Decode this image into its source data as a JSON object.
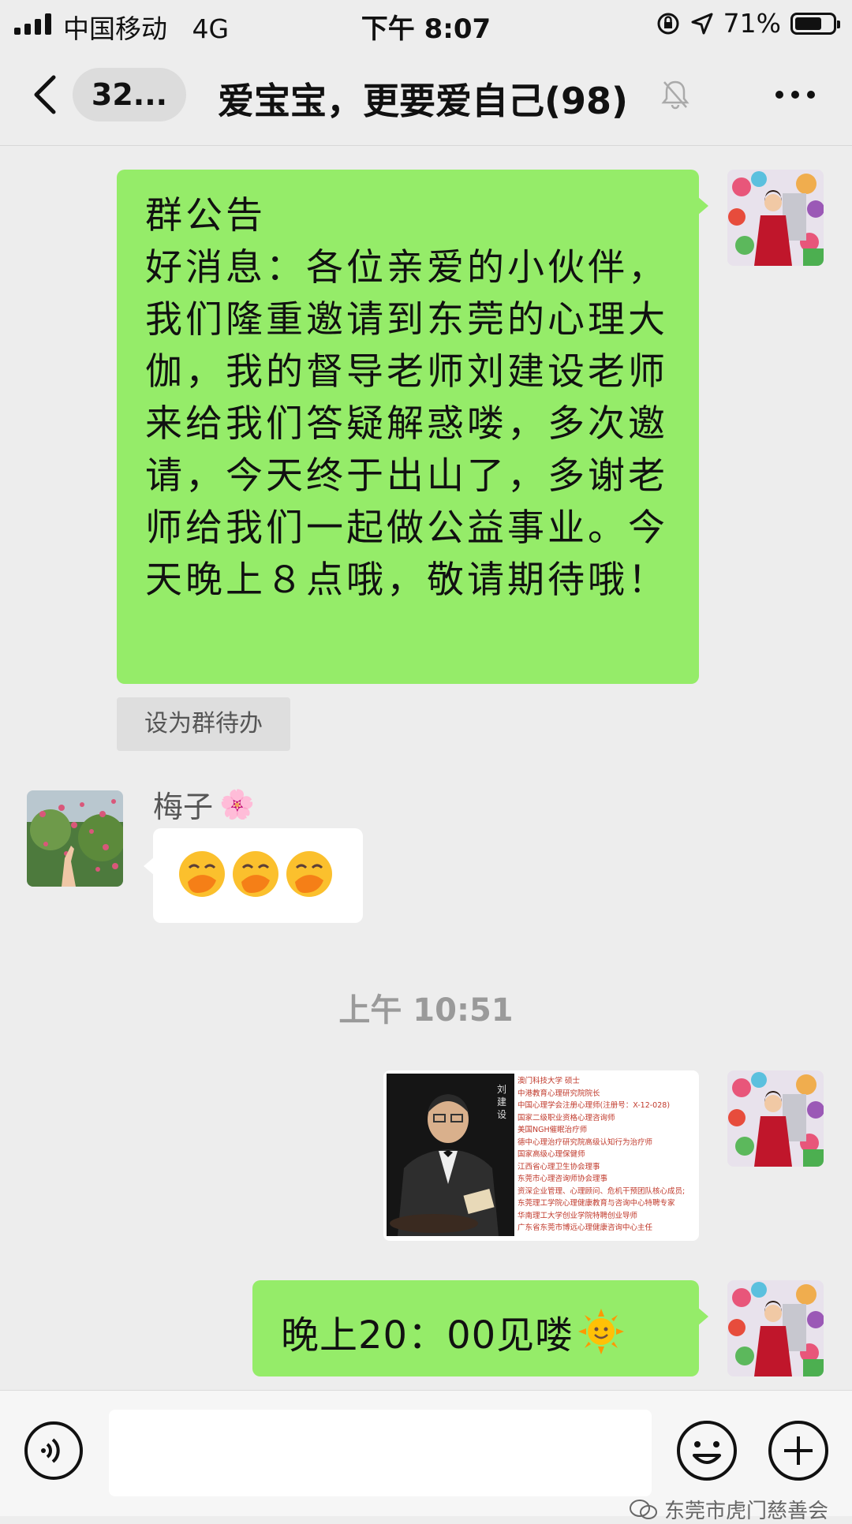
{
  "status_bar": {
    "carrier": "中国移动",
    "network": "4G",
    "time": "下午 8:07",
    "battery": "71%",
    "battery_level": 0.71
  },
  "nav": {
    "unread_count": "32...",
    "title": "爱宝宝，更要爱自己(98)",
    "icons": [
      "back-chevron-icon",
      "mute-bell-icon",
      "more-dots-icon"
    ]
  },
  "messages": {
    "announcement": {
      "heading": "群公告",
      "body": "好消息：各位亲爱的小伙伴，我们隆重邀请到东莞的心理大伽，我的督导老师刘建设老师来给我们答疑解惑喽，多次邀请，今天终于出山了，多谢老师给我们一起做公益事业。今天晚上８点哦，敬请期待哦！"
    },
    "todo_button": "设为群待办",
    "sender_name": "梅子",
    "sender_flower": "🌸",
    "emoji_reply": [
      "🤭",
      "🤭",
      "🤭"
    ],
    "timestamp": "上午 10:51",
    "image_card": {
      "name_vertical": "刘建设",
      "lines": [
        "澳门科技大学 硕士",
        "中港教育心理研究院院长",
        "中国心理学会注册心理师(注册号：X-12-028)",
        "国家二级职业资格心理咨询师",
        "美国NGH催眠治疗师",
        "德中心理治疗研究院高级认知行为治疗师",
        "国家高级心理保健师",
        "江西省心理卫生协会理事",
        "东莞市心理咨询师协会理事",
        "资深企业管理、心理顾问、危机干预团队核心成员;",
        "东莞理工学院心理健康教育与咨询中心特聘专家",
        "华南理工大学创业学院特聘创业导师",
        "广东省东莞市博远心理健康咨询中心主任"
      ]
    },
    "evening": {
      "text": "晚上20：00见喽",
      "emoji": "🌞"
    }
  },
  "watermark": "东莞市虎门慈善会"
}
